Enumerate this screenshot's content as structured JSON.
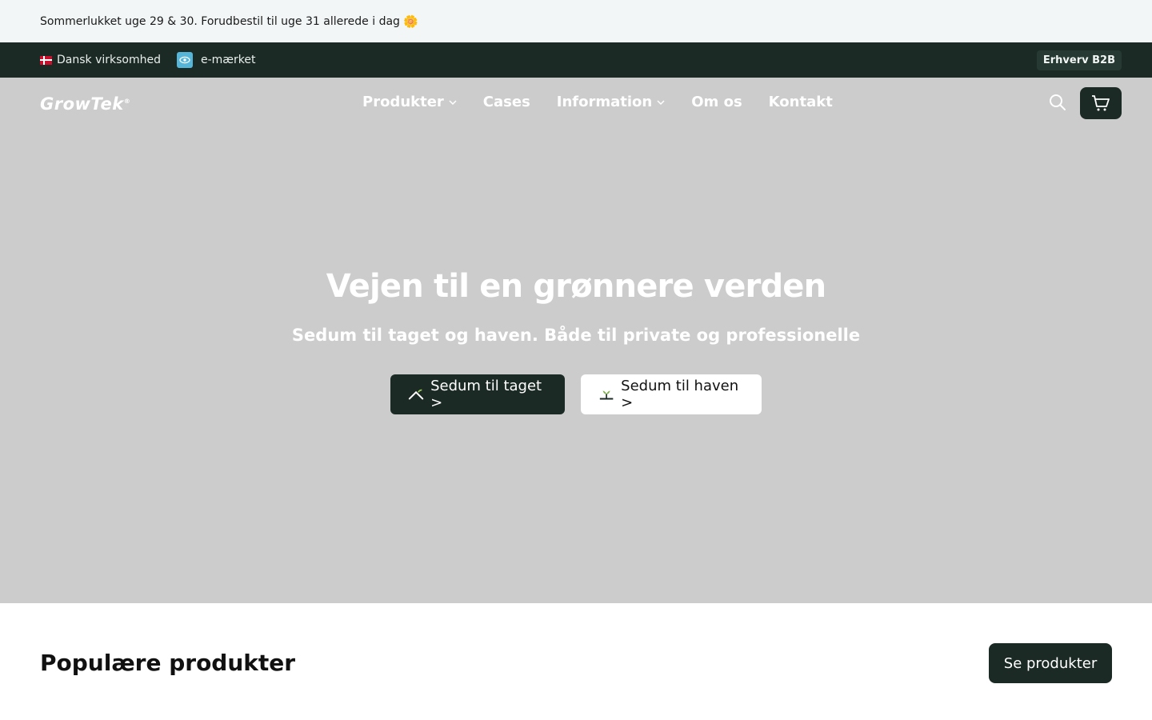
{
  "announcement": {
    "text": "Sommerlukket uge 29 & 30. Forudbestil til uge 31 allerede i dag",
    "emoji": "🌼"
  },
  "topbar": {
    "dansk": "Dansk virksomhed",
    "emaerket": "e-mærket",
    "b2b": "Erhverv B2B"
  },
  "header": {
    "logo": "GrowTek",
    "logo_mark": "®",
    "menu": {
      "produkter": "Produkter",
      "cases": "Cases",
      "information": "Information",
      "om_os": "Om os",
      "kontakt": "Kontakt"
    }
  },
  "hero": {
    "title": "Vejen til en grønnere verden",
    "subtitle": "Sedum til taget og haven. Både til private og professionelle",
    "btn_roof": "Sedum til taget >",
    "btn_garden": "Sedum til haven >"
  },
  "section": {
    "title": "Populære produkter",
    "button": "Se produkter"
  },
  "colors": {
    "dark_green": "#1b2a25",
    "hero_bg": "#cccccc",
    "announce_bg": "#f2f6f7"
  }
}
